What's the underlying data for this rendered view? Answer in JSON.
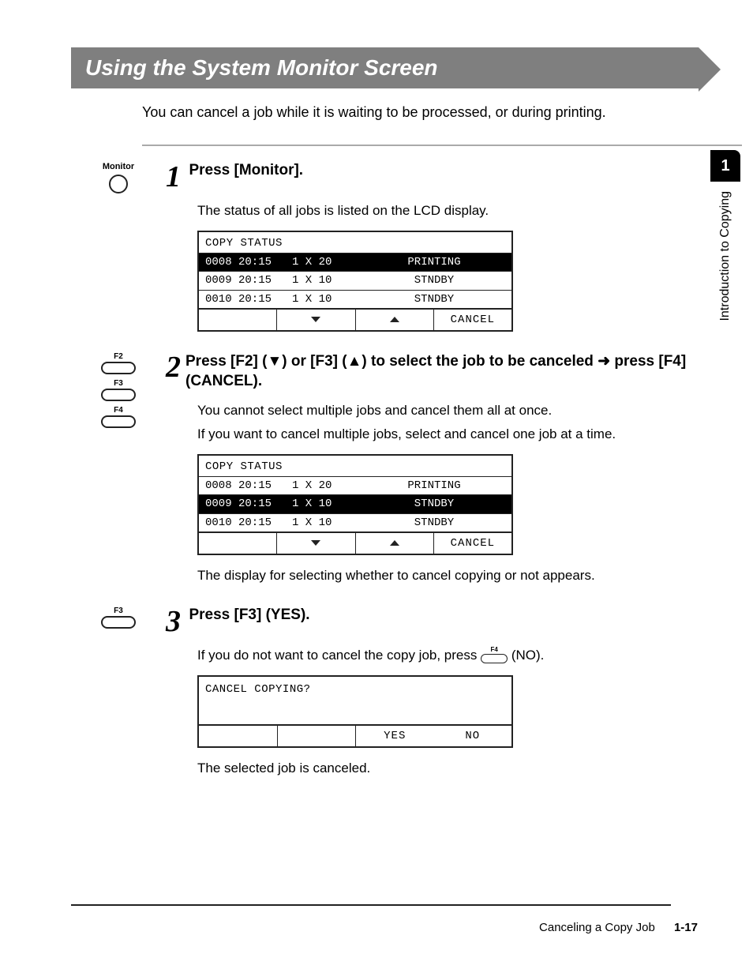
{
  "pageHeading": "Using the System Monitor Screen",
  "intro": "You can cancel a job while it is waiting to be processed, or during printing.",
  "sideTab": {
    "chapterNum": "1",
    "chapterTitle": "Introduction to Copying"
  },
  "keys": {
    "monitor": "Monitor",
    "f2": "F2",
    "f3": "F3",
    "f4": "F4"
  },
  "steps": {
    "s1": {
      "num": "1",
      "head": "Press [Monitor].",
      "body1": "The status of all jobs is listed on the LCD display.",
      "lcd": {
        "title": "COPY STATUS",
        "rows": [
          {
            "c0": "0008 20:15",
            "c1": "1 X 20",
            "c2": "PRINTING",
            "sel": true
          },
          {
            "c0": "0009 20:15",
            "c1": "1 X 10",
            "c2": "STNDBY",
            "sel": false
          },
          {
            "c0": "0010 20:15",
            "c1": "1 X 10",
            "c2": "STNDBY",
            "sel": false
          }
        ],
        "fn4": "CANCEL"
      }
    },
    "s2": {
      "num": "2",
      "headA": "Press [F2] (▼) or [F3] (▲) to select the job to be canceled ➜ press [F4] (CANCEL).",
      "body1": "You cannot select multiple jobs and cancel them all at once.",
      "body2": "If you want to cancel multiple jobs, select and cancel one job at a time.",
      "lcd": {
        "title": "COPY STATUS",
        "rows": [
          {
            "c0": "0008 20:15",
            "c1": "1 X 20",
            "c2": "PRINTING",
            "sel": false
          },
          {
            "c0": "0009 20:15",
            "c1": "1 X 10",
            "c2": "STNDBY",
            "sel": true
          },
          {
            "c0": "0010 20:15",
            "c1": "1 X 10",
            "c2": "STNDBY",
            "sel": false
          }
        ],
        "fn4": "CANCEL"
      },
      "body3": "The display for selecting whether to cancel copying or not appears."
    },
    "s3": {
      "num": "3",
      "head": "Press [F3] (YES).",
      "body1a": "If you do not want to cancel the copy job, press ",
      "body1b": " (NO).",
      "lcd": {
        "prompt": "CANCEL COPYING?",
        "yes": "YES",
        "no": "NO"
      },
      "body2": "The selected job is canceled."
    }
  },
  "footer": {
    "section": "Canceling a Copy Job",
    "page": "1-17"
  }
}
